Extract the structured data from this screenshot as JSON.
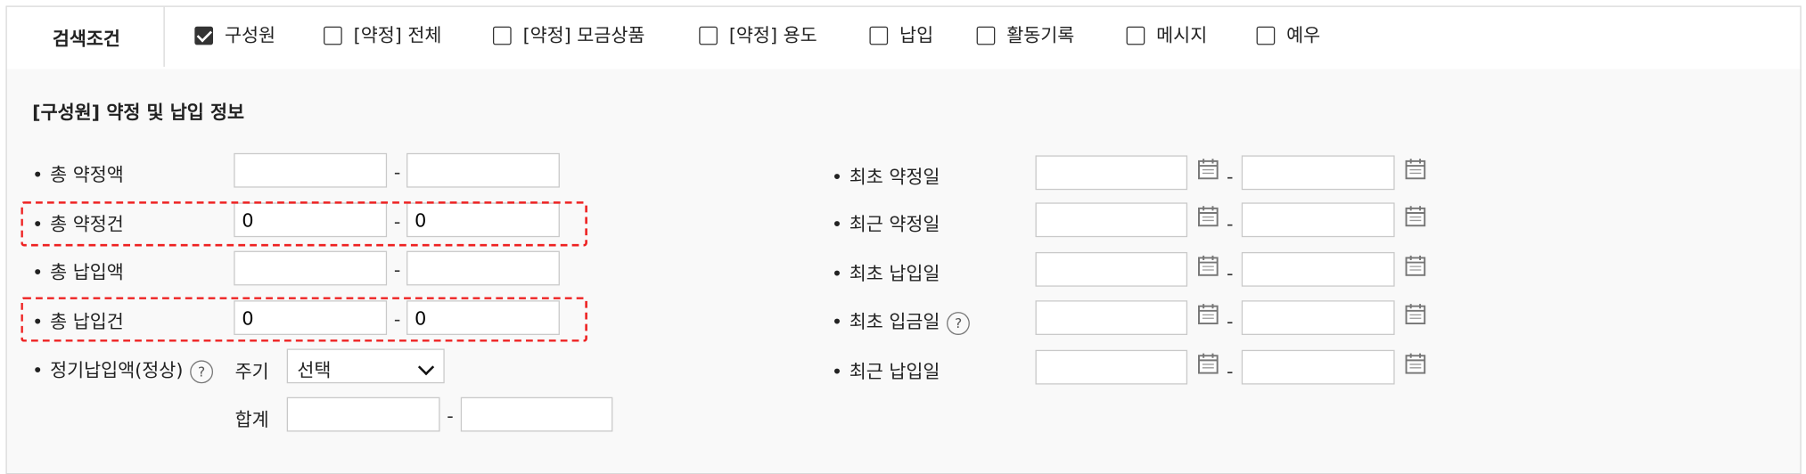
{
  "header": {
    "label": "검색조건",
    "options": [
      {
        "label": "구성원",
        "checked": true
      },
      {
        "label": "[약정] 전체",
        "checked": false
      },
      {
        "label": "[약정] 모금상품",
        "checked": false
      },
      {
        "label": "[약정] 용도",
        "checked": false
      },
      {
        "label": "납입",
        "checked": false
      },
      {
        "label": "활동기록",
        "checked": false
      },
      {
        "label": "메시지",
        "checked": false
      },
      {
        "label": "예우",
        "checked": false
      }
    ]
  },
  "section": {
    "title": "[구성원] 약정 및 납입 정보",
    "left": [
      {
        "label": "총 약정액",
        "from": "",
        "to": ""
      },
      {
        "label": "총 약정건",
        "from": "0",
        "to": "0"
      },
      {
        "label": "총 납입액",
        "from": "",
        "to": ""
      },
      {
        "label": "총 납입건",
        "from": "0",
        "to": "0"
      }
    ],
    "regular": {
      "label": "정기납입액(정상)",
      "cycle_label": "주기",
      "cycle_value": "선택",
      "sum_label": "합계",
      "sum_from": "",
      "sum_to": ""
    },
    "right": [
      {
        "label": "최초 약정일",
        "help": false
      },
      {
        "label": "최근 약정일",
        "help": false
      },
      {
        "label": "최초 납입일",
        "help": false
      },
      {
        "label": "최초 입금일",
        "help": true
      },
      {
        "label": "최근 납입일",
        "help": false
      }
    ]
  },
  "range_dash": "-",
  "bullet_char": "•",
  "help_char": "?"
}
